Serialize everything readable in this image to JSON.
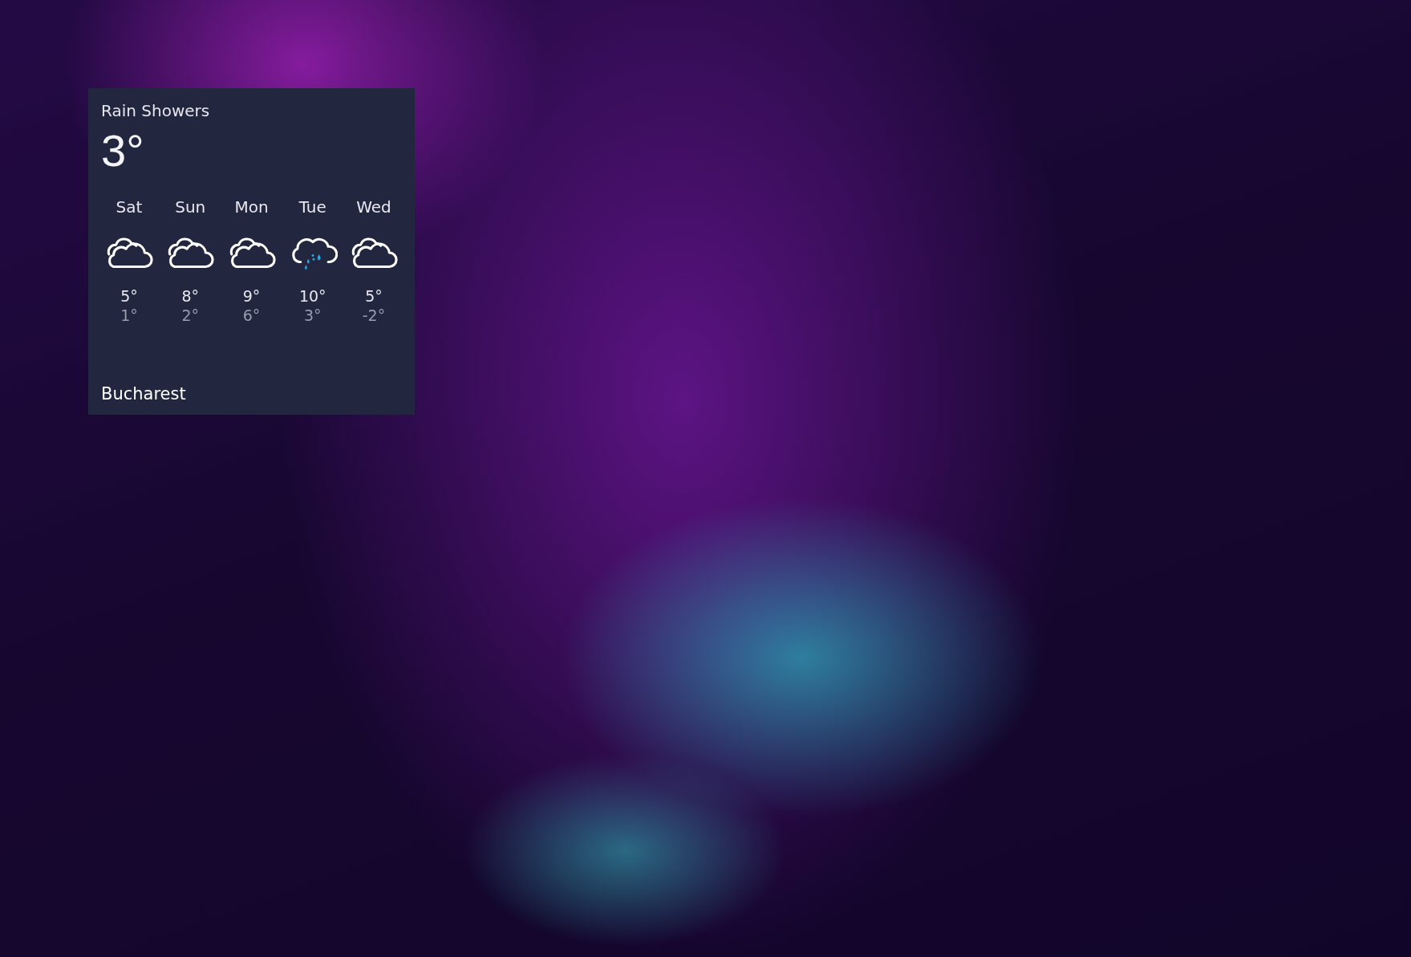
{
  "widget": {
    "condition": "Rain Showers",
    "temperature": "3°",
    "location": "Bucharest",
    "forecast": [
      {
        "day": "Sat",
        "kind": "cloudy",
        "high": "5°",
        "low": "1°"
      },
      {
        "day": "Sun",
        "kind": "cloudy",
        "high": "8°",
        "low": "2°"
      },
      {
        "day": "Mon",
        "kind": "cloudy",
        "high": "9°",
        "low": "6°"
      },
      {
        "day": "Tue",
        "kind": "rain",
        "high": "10°",
        "low": "3°"
      },
      {
        "day": "Wed",
        "kind": "cloudy",
        "high": "5°",
        "low": "-2°"
      }
    ]
  }
}
